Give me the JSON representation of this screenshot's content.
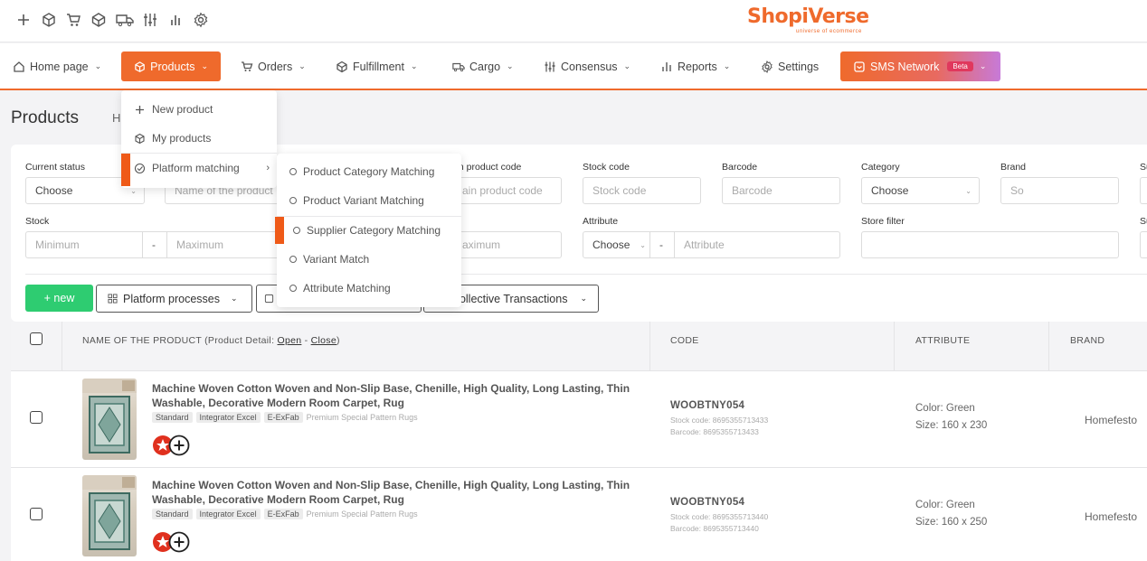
{
  "colors": {
    "accent": "#ef6a2c",
    "success": "#2ecc71",
    "beta": "#e0385d"
  },
  "logo": {
    "text": "ShopiVerse",
    "tagline": "universe of ecommerce"
  },
  "topbar_icons": [
    "plus-icon",
    "box-icon",
    "cart-icon",
    "cube-icon",
    "truck-icon",
    "sliders-icon",
    "bar-chart-icon",
    "gear-icon"
  ],
  "nav": {
    "home": "Home page",
    "products": "Products",
    "orders": "Orders",
    "fulfillment": "Fulfillment",
    "cargo": "Cargo",
    "consensus": "Consensus",
    "reports": "Reports",
    "settings": "Settings",
    "sms": "SMS Network",
    "beta": "Beta"
  },
  "page": {
    "title": "Products",
    "breadcrumb": "H"
  },
  "products_menu": {
    "new_product": "New product",
    "my_products": "My products",
    "platform_matching": "Platform matching"
  },
  "matching_menu": [
    "Product Category Matching",
    "Product Variant Matching",
    "Supplier Category Matching",
    "Variant Match",
    "Attribute Matching"
  ],
  "filters": {
    "current_status": {
      "label": "Current status",
      "value": "Choose"
    },
    "product_name": {
      "placeholder": "Name of the product"
    },
    "main_code": {
      "label": "Main product code",
      "placeholder": "Main product code"
    },
    "stock_code": {
      "label": "Stock code",
      "placeholder": "Stock code"
    },
    "barcode": {
      "label": "Barcode",
      "placeholder": "Barcode"
    },
    "category": {
      "label": "Category",
      "value": "Choose"
    },
    "brand": {
      "label": "Brand",
      "placeholder": "So"
    },
    "su": {
      "label": "Su"
    },
    "stock": {
      "label": "Stock",
      "min": "Minimum",
      "max": "Maximum",
      "dash": "-"
    },
    "price_max": {
      "placeholder": "Maximum"
    },
    "attribute": {
      "label": "Attribute",
      "value": "Choose",
      "placeholder": "Attribute",
      "dash": "-"
    },
    "store_filter": {
      "label": "Store filter"
    },
    "su2": {
      "label": "Su"
    }
  },
  "actions": {
    "new": "+ new",
    "platform_processes": "Platform processes",
    "collective": "Collective Transactions"
  },
  "table": {
    "headers": {
      "name": "NAME OF THE PRODUCT (Product Detail:",
      "open": "Open",
      "sep": "-",
      "close": "Close",
      "end": ")",
      "code": "CODE",
      "attribute": "ATTRIBUTE",
      "brand": "BRAND"
    },
    "rows": [
      {
        "name": "Machine Woven Cotton Woven and Non-Slip Base, Chenille, High Quality, Long Lasting, Thin Washable, Decorative Modern Room Carpet, Rug",
        "tags": [
          "Standard",
          "Integrator Excel",
          "E-ExFab"
        ],
        "category": "Premium Special Pattern Rugs",
        "code": "WOOBTNY054",
        "stock_code": "Stock code: 8695355713433",
        "barcode": "Barcode: 8695355713433",
        "color": "Color: Green",
        "size": "Size: 160 x 230",
        "brand": "Homefesto"
      },
      {
        "name": "Machine Woven Cotton Woven and Non-Slip Base, Chenille, High Quality, Long Lasting, Thin Washable, Decorative Modern Room Carpet, Rug",
        "tags": [
          "Standard",
          "Integrator Excel",
          "E-ExFab"
        ],
        "category": "Premium Special Pattern Rugs",
        "code": "WOOBTNY054",
        "stock_code": "Stock code: 8695355713440",
        "barcode": "Barcode: 8695355713440",
        "color": "Color: Green",
        "size": "Size: 160 x 250",
        "brand": "Homefesto"
      }
    ]
  }
}
